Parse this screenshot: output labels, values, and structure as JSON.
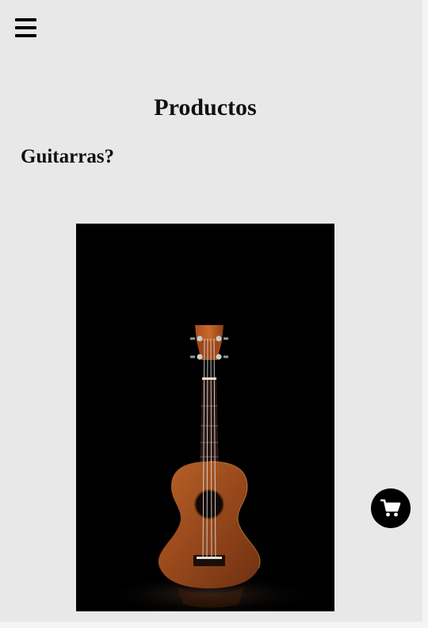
{
  "header": {
    "menu_icon": "hamburger-menu-icon"
  },
  "main": {
    "title": "Productos",
    "section_heading": "Guitarras?",
    "product_image": {
      "subject": "ukulele",
      "background": "#000000",
      "body_color": "#9a4a1c"
    }
  },
  "floating_cart": {
    "icon": "shopping-cart-icon",
    "background": "#000000",
    "icon_color": "#ffffff"
  }
}
